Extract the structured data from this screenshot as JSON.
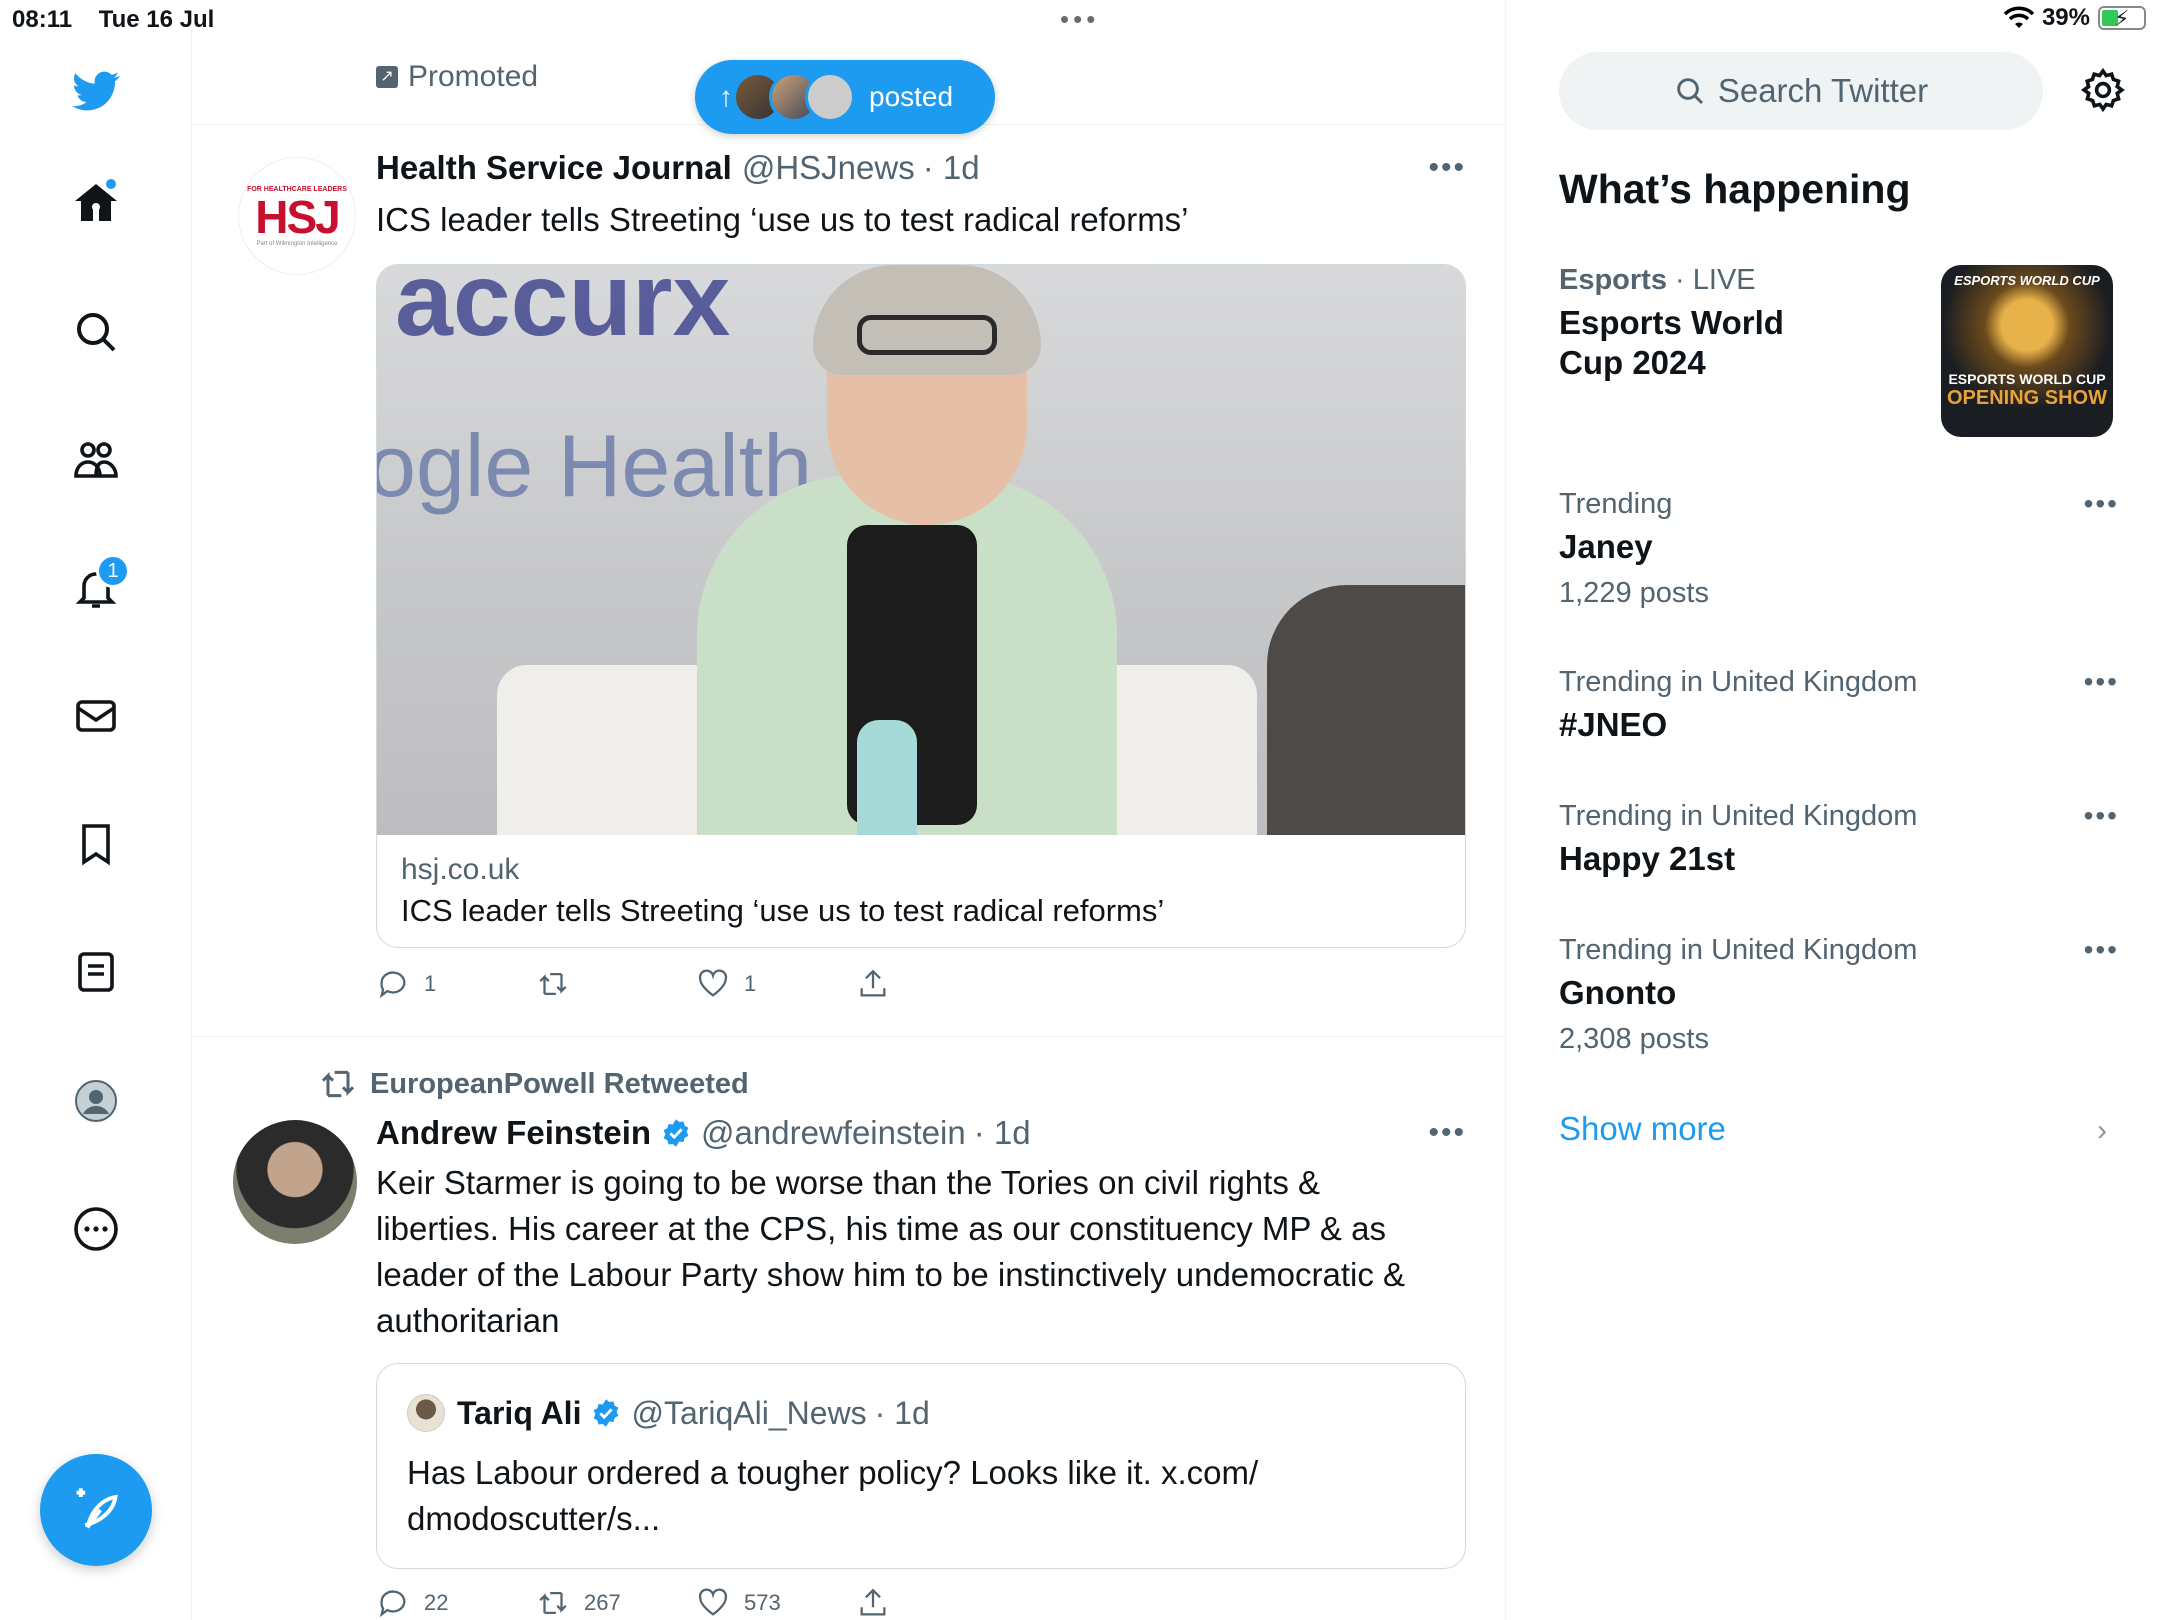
{
  "status_bar": {
    "time": "08:11",
    "date": "Tue 16 Jul",
    "battery": "39%",
    "top_dots": "•••"
  },
  "nav": {
    "notifications_count": "1",
    "items": [
      "home",
      "explore",
      "communities",
      "notifications",
      "messages",
      "bookmarks",
      "lists",
      "profile",
      "more"
    ],
    "compose": "compose"
  },
  "feed": {
    "promoted_label": "Promoted",
    "new_posts_pill": "posted",
    "tweet1": {
      "name": "Health Service Journal",
      "handle": "@HSJnews",
      "time": "· 1d",
      "text": "ICS leader tells Streeting ‘use us to test radical reforms’",
      "avatar": {
        "small": "FOR HEALTHCARE LEADERS",
        "big": "HSJ",
        "sub": "Part of Wilmington Intelligence"
      },
      "image_text1": "accurx",
      "image_text2": "ogle Health",
      "card_domain": "hsj.co.uk",
      "card_title": "ICS leader tells Streeting ‘use us to test radical reforms’",
      "replies": "1",
      "retweets": "",
      "likes": "1"
    },
    "tweet2": {
      "retweeted_by": "EuropeanPowell Retweeted",
      "name": "Andrew Feinstein",
      "handle": "@andrewfeinstein",
      "time": "· 1d",
      "text_lines": [
        "Keir Starmer is going to be worse than the Tories on civil rights &",
        "liberties. His career at the CPS, his time as our constituency MP & as",
        "leader of the Labour Party show him to be instinctively undemocratic &",
        "authoritarian"
      ],
      "quote": {
        "name": "Tariq Ali",
        "handle": "@TariqAli_News",
        "time": "· 1d",
        "text_line1": "Has Labour ordered a tougher policy? Looks like it. x.com/",
        "text_line2": "dmodoscutter/s..."
      },
      "replies": "22",
      "retweets": "267",
      "likes": "573"
    }
  },
  "sidebar": {
    "search_placeholder": "Search Twitter",
    "whats_happening": "What’s happening",
    "esports": {
      "category": "Esports",
      "live": " · LIVE",
      "title_line1": "Esports World",
      "title_line2": "Cup 2024",
      "thumb_top": "ESPORTS WORLD CUP",
      "thumb_mid": "ESPORTS WORLD CUP",
      "thumb_bottom": "OPENING SHOW"
    },
    "trends": [
      {
        "category": "Trending",
        "name": "Janey",
        "count": "1,229 posts"
      },
      {
        "category": "Trending in United Kingdom",
        "name": "#JNEO",
        "count": ""
      },
      {
        "category": "Trending in United Kingdom",
        "name": "Happy 21st",
        "count": ""
      },
      {
        "category": "Trending in United Kingdom",
        "name": "Gnonto",
        "count": "2,308 posts"
      }
    ],
    "show_more": "Show more"
  },
  "colors": {
    "accent": "#1d9bf0",
    "text": "#0f1419",
    "secondary": "#536471",
    "border": "#cfd9de",
    "brand_red": "#c8102e"
  }
}
